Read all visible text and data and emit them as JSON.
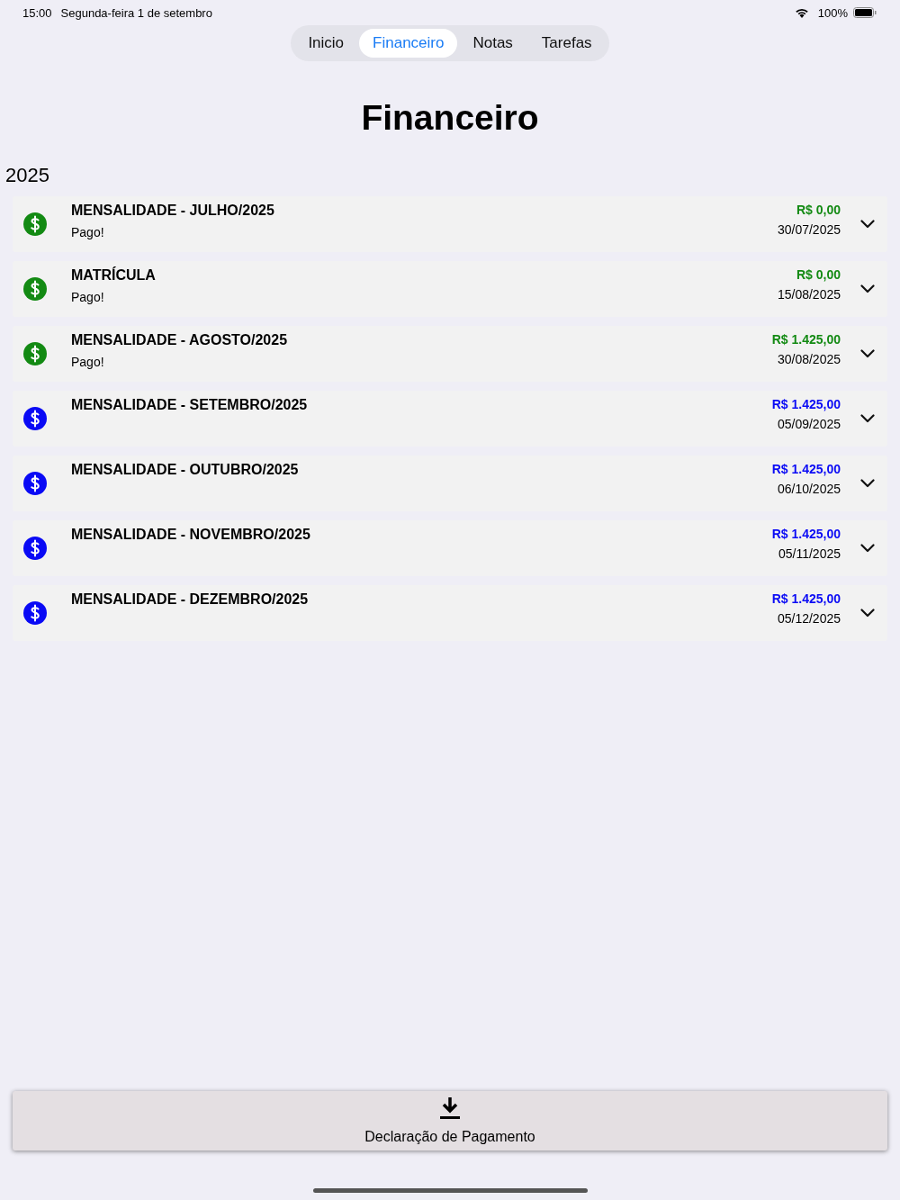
{
  "status_bar": {
    "time": "15:00",
    "date": "Segunda-feira 1 de setembro",
    "battery": "100%"
  },
  "tabs": [
    {
      "label": "Inicio",
      "selected": false
    },
    {
      "label": "Financeiro",
      "selected": true
    },
    {
      "label": "Notas",
      "selected": false
    },
    {
      "label": "Tarefas",
      "selected": false
    }
  ],
  "title": "Financeiro",
  "year": "2025",
  "items": [
    {
      "title": "MENSALIDADE - JULHO/2025",
      "status": "Pago!",
      "paid": true,
      "amount": "R$ 0,00",
      "date": "30/07/2025"
    },
    {
      "title": "MATRÍCULA",
      "status": "Pago!",
      "paid": true,
      "amount": "R$ 0,00",
      "date": "15/08/2025"
    },
    {
      "title": "MENSALIDADE - AGOSTO/2025",
      "status": "Pago!",
      "paid": true,
      "amount": "R$ 1.425,00",
      "date": "30/08/2025"
    },
    {
      "title": "MENSALIDADE - SETEMBRO/2025",
      "paid": false,
      "amount": "R$ 1.425,00",
      "date": "05/09/2025"
    },
    {
      "title": "MENSALIDADE - OUTUBRO/2025",
      "paid": false,
      "amount": "R$ 1.425,00",
      "date": "06/10/2025"
    },
    {
      "title": "MENSALIDADE - NOVEMBRO/2025",
      "paid": false,
      "amount": "R$ 1.425,00",
      "date": "05/11/2025"
    },
    {
      "title": "MENSALIDADE - DEZEMBRO/2025",
      "paid": false,
      "amount": "R$ 1.425,00",
      "date": "05/12/2025"
    }
  ],
  "download_button": {
    "label": "Declaração de Pagamento"
  }
}
